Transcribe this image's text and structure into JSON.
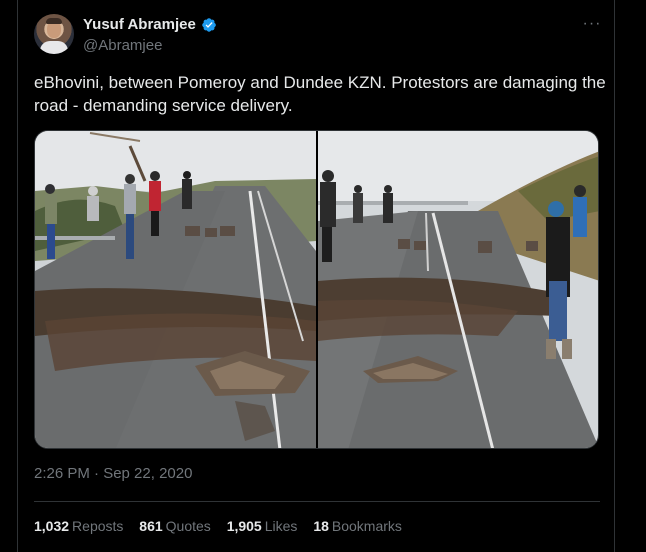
{
  "author": {
    "display_name": "Yusuf Abramjee",
    "handle": "@Abramjee",
    "verified": true
  },
  "tweet": {
    "text": "eBhovini, between Pomeroy and Dundee KZN.  Protestors are damaging the road - demanding service delivery.",
    "timestamp": "2:26 PM · Sep 22, 2020"
  },
  "stats": {
    "reposts_count": "1,032",
    "reposts_label": "Reposts",
    "quotes_count": "861",
    "quotes_label": "Quotes",
    "likes_count": "1,905",
    "likes_label": "Likes",
    "bookmarks_count": "18",
    "bookmarks_label": "Bookmarks"
  },
  "icons": {
    "verified": "verified-badge-icon",
    "more": "more-options-icon"
  },
  "colors": {
    "background": "#000000",
    "primary_text": "#e7e9ea",
    "secondary_text": "#71767b",
    "verified_blue": "#1d9bf0",
    "border": "#2f3336"
  }
}
